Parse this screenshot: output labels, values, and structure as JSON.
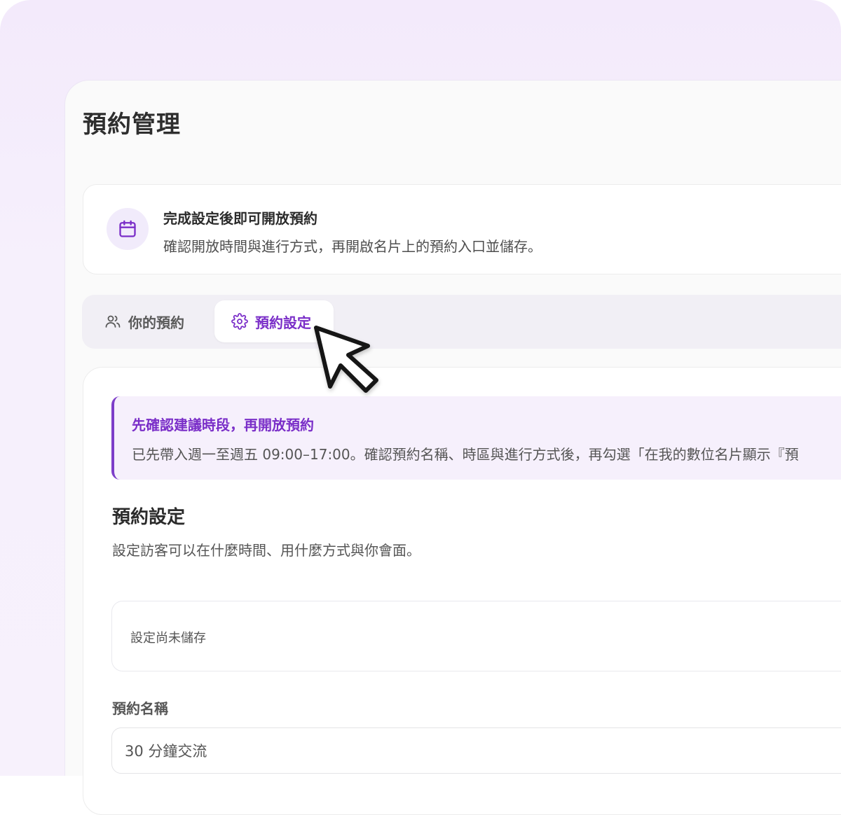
{
  "page": {
    "title": "預約管理"
  },
  "notice": {
    "title": "完成設定後即可開放預約",
    "description": "確認開放時間與進行方式，再開啟名片上的預約入口並儲存。",
    "icon": "calendar-icon"
  },
  "tabs": [
    {
      "label": "你的預約",
      "icon": "users-icon",
      "active": false
    },
    {
      "label": "預約設定",
      "icon": "gear-icon",
      "active": true
    }
  ],
  "callout": {
    "title": "先確認建議時段，再開放預約",
    "body": "已先帶入週一至週五 09:00–17:00。確認預約名稱、時區與進行方式後，再勾選「在我的數位名片顯示『預"
  },
  "settings": {
    "title": "預約設定",
    "description": "設定訪客可以在什麼時間、用什麼方式與你會面。",
    "status": "設定尚未儲存"
  },
  "form": {
    "name_label": "預約名稱",
    "name_value": "30 分鐘交流"
  },
  "colors": {
    "accent": "#7a2ec8",
    "accent_soft": "#f6f0fc",
    "background": "#f3eafb"
  }
}
